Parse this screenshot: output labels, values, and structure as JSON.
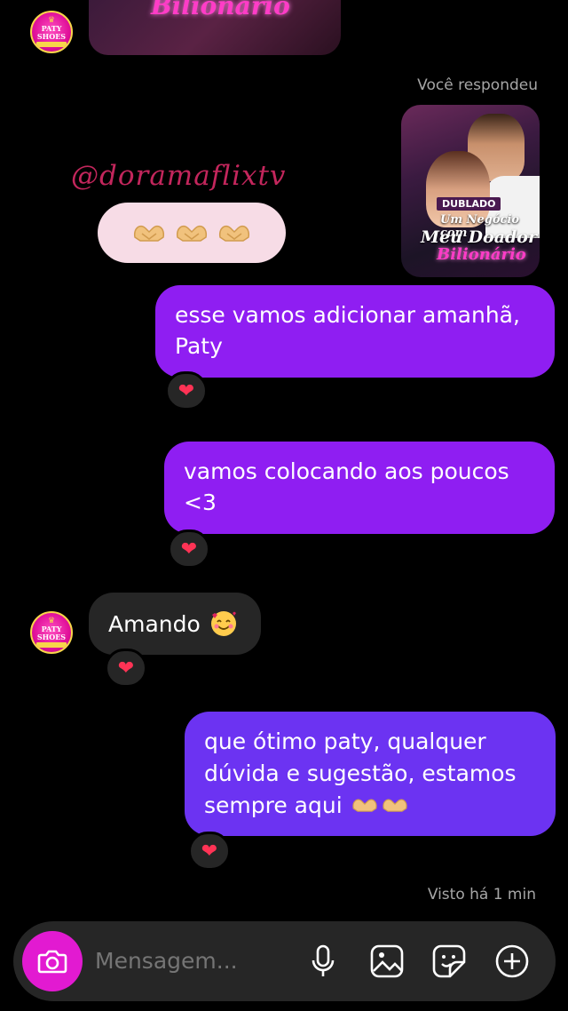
{
  "thread": {
    "you_replied_label": "Você respondeu",
    "watermark": "@doramaflixtv",
    "seen_status": "Visto há 1 min",
    "contact_avatar": {
      "brand_line1": "PATY",
      "brand_line2": "SHOES"
    },
    "previous_media": {
      "title_fragment": "Bilionário"
    },
    "replied_media": {
      "badge": "DUBLADO",
      "title_line1": "Um Negócio com",
      "title_line2": "Meu Doador",
      "title_line3": "Bilionário"
    },
    "messages": [
      {
        "direction": "outgoing",
        "text": "esse vamos adicionar amanhã, Paty",
        "reaction": "heart"
      },
      {
        "direction": "outgoing",
        "text": "vamos colocando aos poucos <3",
        "reaction": "heart"
      },
      {
        "direction": "incoming",
        "text": "Amando",
        "emoji": "smiling-face-with-hearts",
        "reaction": "heart"
      },
      {
        "direction": "outgoing",
        "text": "que ótimo paty, qualquer dúvida e sugestão, estamos sempre aqui",
        "emoji": "heart-hands x2",
        "reaction": "heart"
      }
    ]
  },
  "composer": {
    "placeholder": "Mensagem...",
    "icons": [
      "camera-icon",
      "microphone-icon",
      "gallery-icon",
      "sticker-icon",
      "plus-icon"
    ]
  },
  "colors": {
    "outgoing_bubble": "#8f1ef2",
    "outgoing_bubble_latest": "#6c33f2",
    "incoming_bubble": "#262626",
    "camera_button": "#e21ad1",
    "reaction_heart": "#ff3355",
    "watermark": "#c3265c"
  }
}
